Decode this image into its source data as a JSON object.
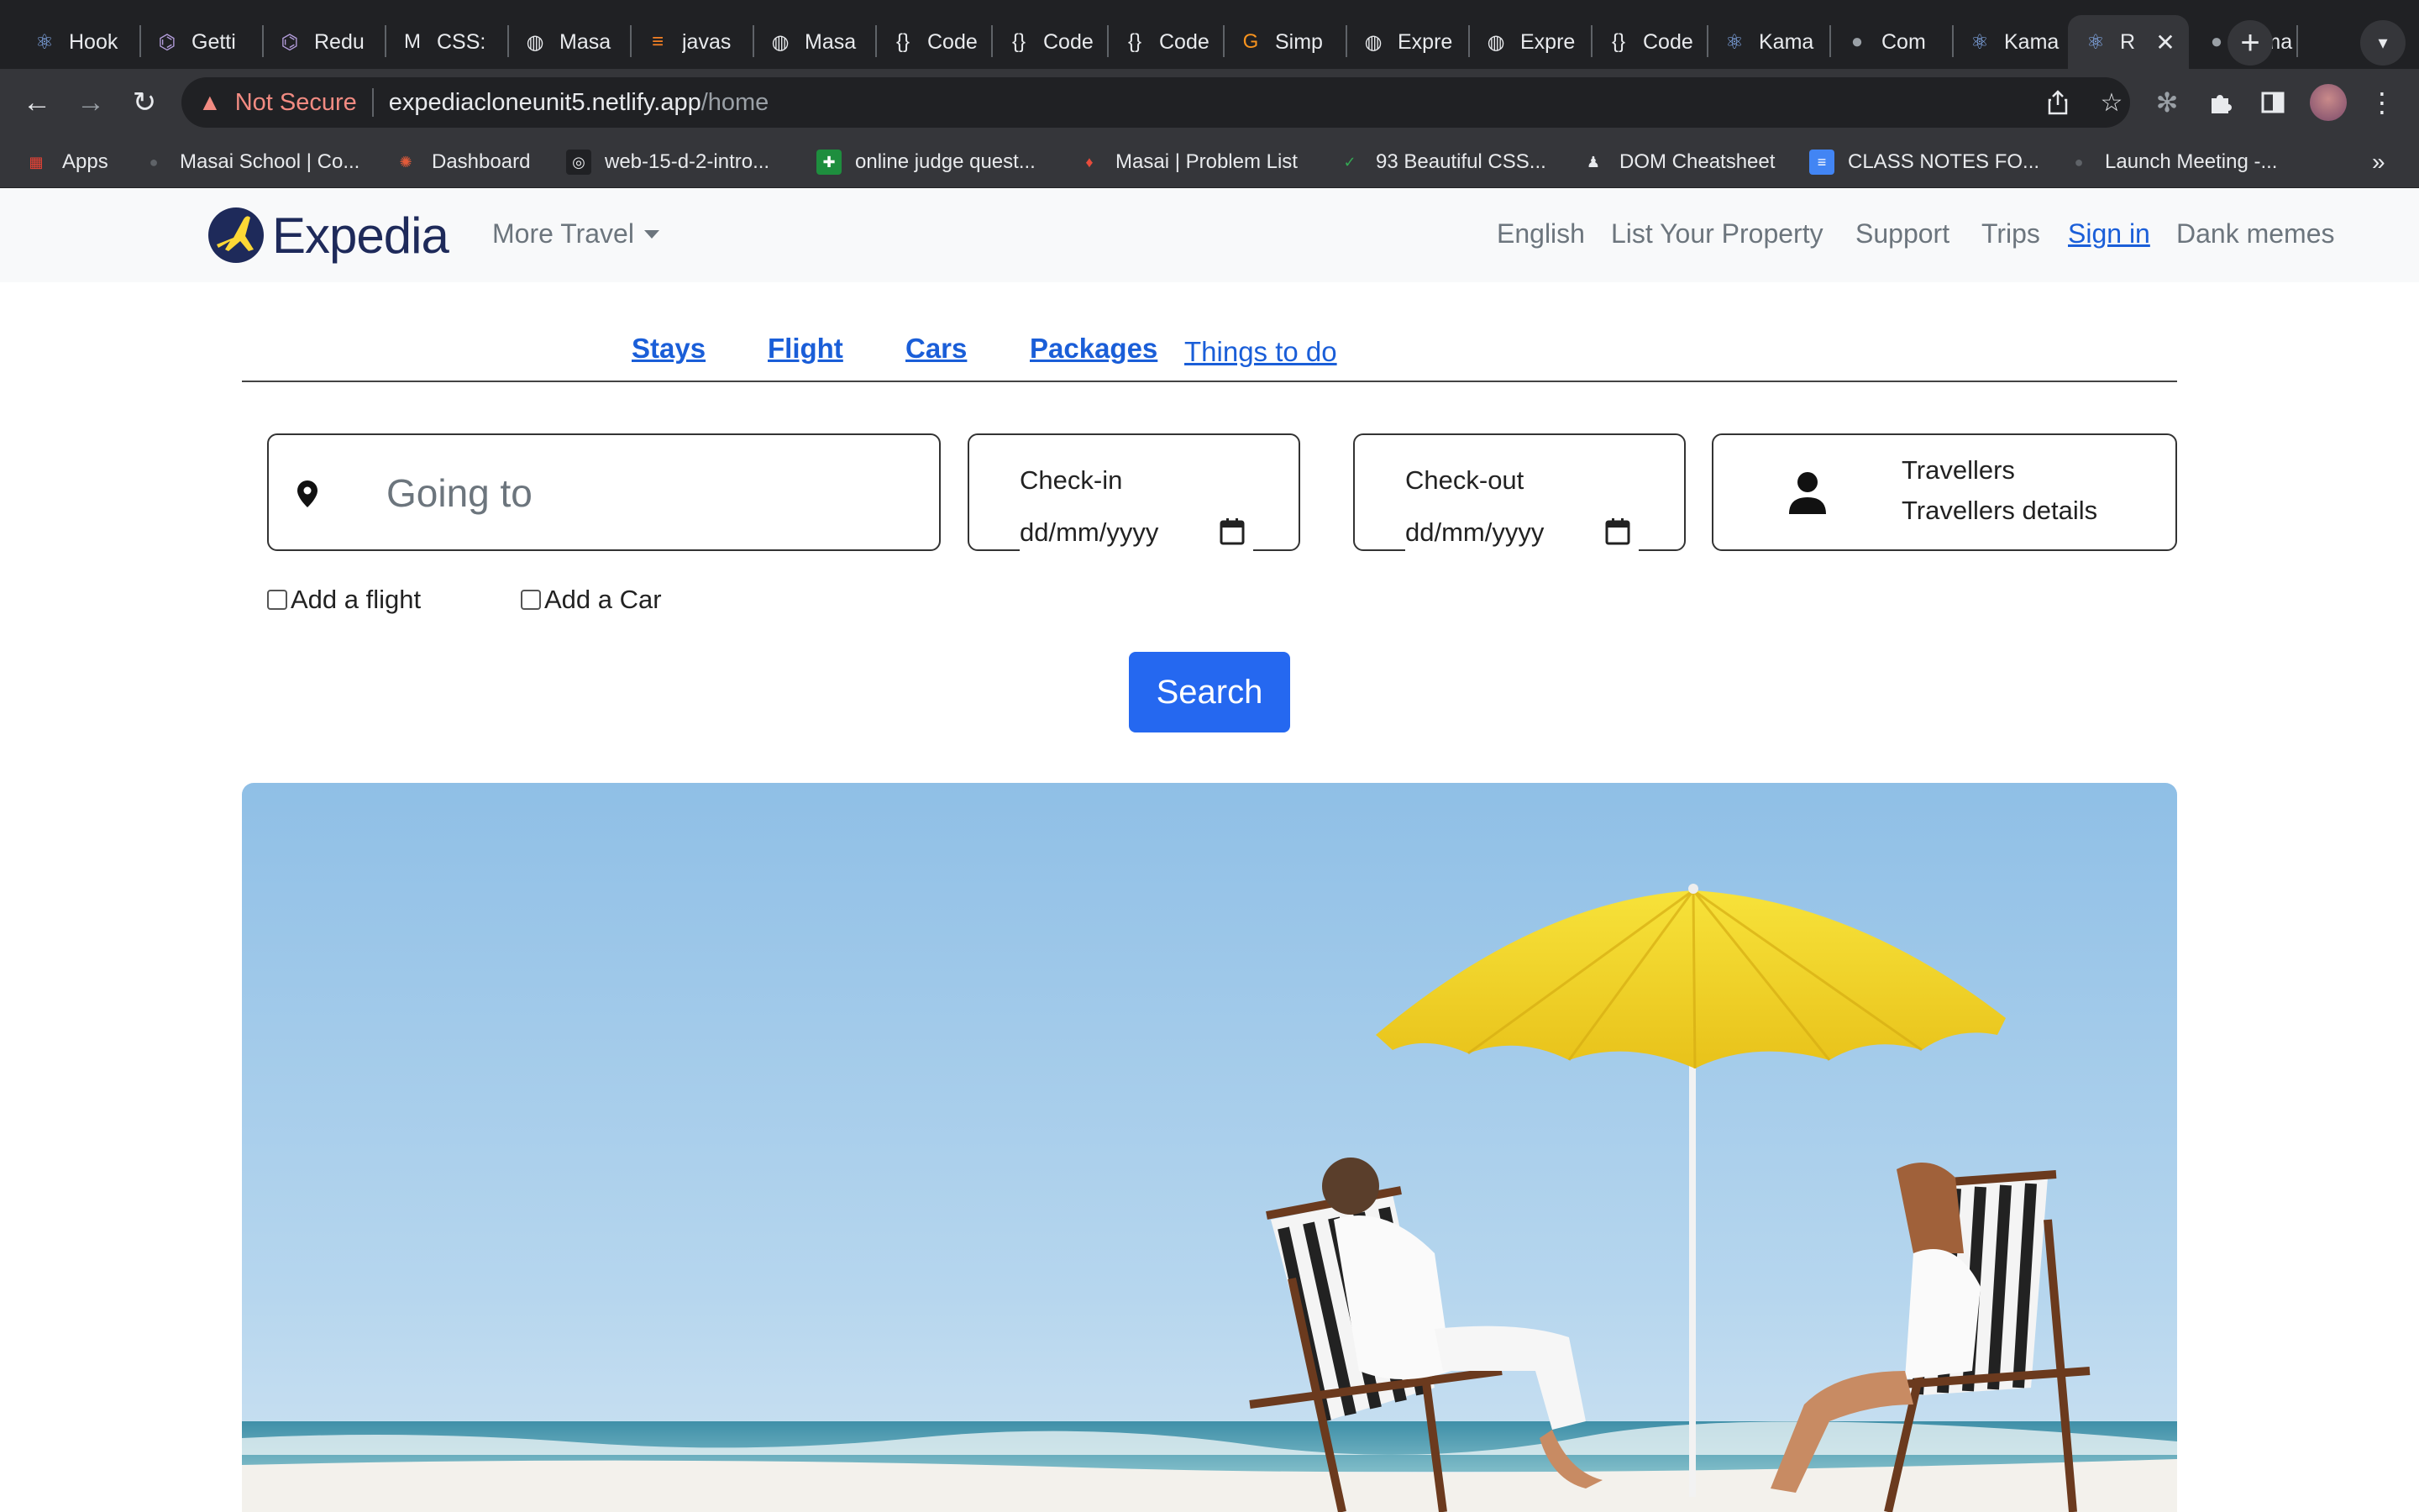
{
  "browser": {
    "tabs": [
      {
        "title": "Hook",
        "icon": "react-icon"
      },
      {
        "title": "Getti",
        "icon": "redux-icon"
      },
      {
        "title": "Redu",
        "icon": "redux-icon"
      },
      {
        "title": "CSS:",
        "icon": "mdn-icon"
      },
      {
        "title": "Masa",
        "icon": "globe-icon"
      },
      {
        "title": "javas",
        "icon": "stackoverflow-icon"
      },
      {
        "title": "Masa",
        "icon": "globe-icon"
      },
      {
        "title": "Code",
        "icon": "codesandbox-icon"
      },
      {
        "title": "Code",
        "icon": "codesandbox-icon"
      },
      {
        "title": "Code",
        "icon": "codesandbox-icon"
      },
      {
        "title": "Simp",
        "icon": "simplilearn-icon"
      },
      {
        "title": "Expre",
        "icon": "globe-icon"
      },
      {
        "title": "Expre",
        "icon": "globe-icon"
      },
      {
        "title": "Code",
        "icon": "codesandbox-icon"
      },
      {
        "title": "Kama",
        "icon": "react-icon"
      },
      {
        "title": "Com",
        "icon": "github-icon"
      },
      {
        "title": "Kama",
        "icon": "react-icon"
      },
      {
        "title": "R",
        "icon": "react-icon",
        "active": true
      },
      {
        "title": "kama",
        "icon": "github-icon"
      }
    ],
    "security_label": "Not Secure",
    "url_host": "expediacloneunit5.netlify.app",
    "url_path": "/home",
    "bookmarks": [
      {
        "label": "Apps",
        "icon": "apps-grid-icon"
      },
      {
        "label": "Masai School | Co...",
        "icon": "globe-icon"
      },
      {
        "label": "Dashboard",
        "icon": "dashboard-icon"
      },
      {
        "label": "web-15-d-2-intro...",
        "icon": "loom-icon"
      },
      {
        "label": "online judge quest...",
        "icon": "sheets-icon"
      },
      {
        "label": "Masai | Problem List",
        "icon": "masai-icon"
      },
      {
        "label": "93 Beautiful CSS...",
        "icon": "css-icon"
      },
      {
        "label": "DOM Cheatsheet",
        "icon": "dom-icon"
      },
      {
        "label": "CLASS NOTES FO...",
        "icon": "docs-icon"
      },
      {
        "label": "Launch Meeting -...",
        "icon": "zoom-icon"
      }
    ],
    "bookmarks_overflow": "»"
  },
  "site": {
    "brand": "Expedia",
    "more_travel": "More Travel",
    "nav": [
      {
        "label": "English"
      },
      {
        "label": "List Your Property"
      },
      {
        "label": "Support"
      },
      {
        "label": "Trips"
      },
      {
        "label": "Sign in",
        "active": true
      },
      {
        "label": "Dank memes"
      }
    ],
    "categories": [
      "Stays",
      "Flight",
      "Cars",
      "Packages",
      "Things to do"
    ],
    "search": {
      "going_to_placeholder": "Going to",
      "checkin_label": "Check-in",
      "checkin_value": "dd/mm/yyyy",
      "checkout_label": "Check-out",
      "checkout_value": "dd/mm/yyyy",
      "travellers_label": "Travellers",
      "travellers_details": "Travellers details",
      "add_flight": "Add a flight",
      "add_car": "Add a Car",
      "button": "Search"
    },
    "colors": {
      "link": "#1a5ed8",
      "button": "#2568f0",
      "brand_navy": "#1e2a5a",
      "logo_yellow": "#fdd835"
    }
  }
}
